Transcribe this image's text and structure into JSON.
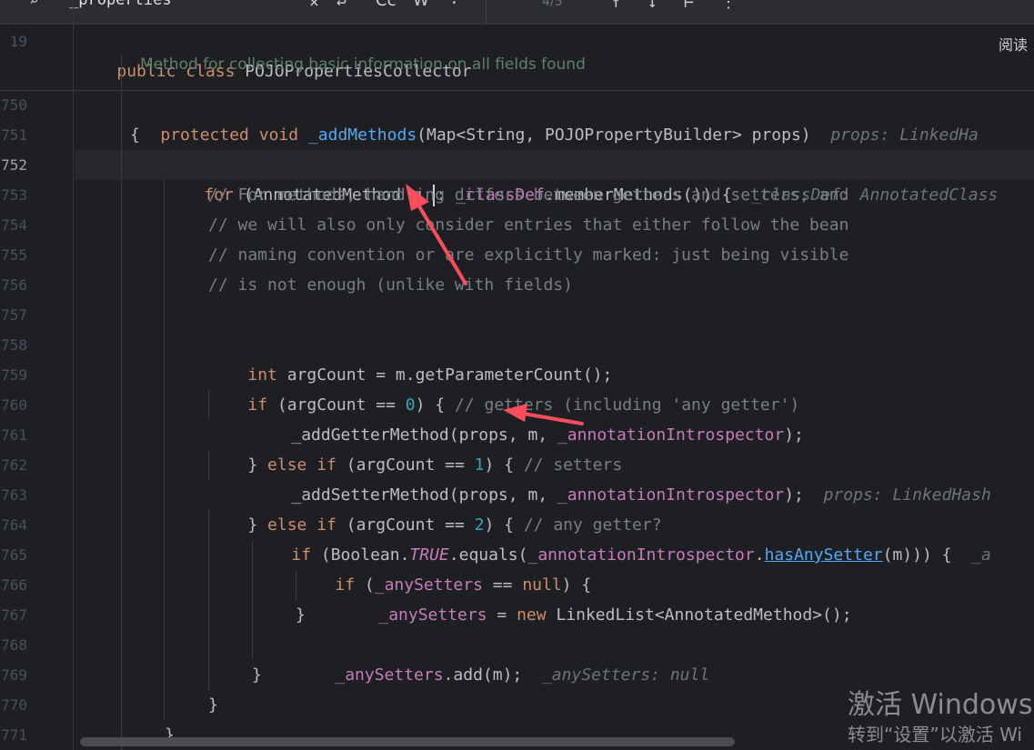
{
  "findbar": {
    "query": "_properties",
    "match_count": "4/5",
    "case_label": "Cc",
    "word_label": "W",
    "regex_label": ".*"
  },
  "sticky": {
    "line_number": "19",
    "class_decl": [
      "public",
      "class",
      "POJOPropertiesCollector"
    ],
    "doc_comment": "Method for collecting basic information on all fields found"
  },
  "side_panel_label": "阅读",
  "line_numbers": [
    "750",
    "751",
    "752",
    "753",
    "754",
    "755",
    "756",
    "757",
    "758",
    "759",
    "760",
    "761",
    "762",
    "763",
    "764",
    "765",
    "766",
    "767",
    "768",
    "769",
    "770",
    "771"
  ],
  "code": {
    "l750": {
      "kw1": "protected",
      "kw2": "void",
      "name": "_addMethods",
      "params": "(Map<String, POJOPropertyBuilder> props)",
      "hint": "props: LinkedHa"
    },
    "l751": {
      "text": "{"
    },
    "l752": {
      "kw": "for",
      "a": "(AnnotatedMethod m ",
      "b": ": ",
      "field": "_classDef",
      "c": ".memberMethods()) {",
      "hint": "_classDef: AnnotatedClass"
    },
    "l753": {
      "text": "// For methods, handling differs between getters and setters; and"
    },
    "l754": {
      "text": "// we will also only consider entries that either follow the bean"
    },
    "l755": {
      "text": "// naming convention or are explicitly marked: just being visible"
    },
    "l756": {
      "text": "// is not enough (unlike with fields)"
    },
    "l758": {
      "kw": "int",
      "rest": " argCount = m.getParameterCount();"
    },
    "l759": {
      "kw": "if",
      "a": " (argCount == ",
      "num": "0",
      "b": ") { ",
      "cmt": "// getters (including 'any getter')"
    },
    "l760": {
      "a": "_addGetterMethod(props, m, ",
      "field": "_annotationIntrospector",
      "b": ");"
    },
    "l761": {
      "a": "} ",
      "kw": "else if",
      "b": " (argCount == ",
      "num": "1",
      "c": ") { ",
      "cmt": "// setters"
    },
    "l762": {
      "a": "_addSetterMethod(props, m, ",
      "field": "_annotationIntrospector",
      "b": ");",
      "hint": "props: LinkedHash"
    },
    "l763": {
      "a": "} ",
      "kw": "else if",
      "b": " (argCount == ",
      "num": "2",
      "c": ") { ",
      "cmt": "// any getter?"
    },
    "l764": {
      "kw": "if",
      "a": " (Boolean.",
      "const": "TRUE",
      "b": ".equals(",
      "field": "_annotationIntrospector",
      "c": ".",
      "link": "hasAnySetter",
      "d": "(m))) {",
      "hint": "_a"
    },
    "l765": {
      "kw": "if",
      "a": " (",
      "field": "_anySetters",
      "b": " == ",
      "kw2": "null",
      "c": ") {"
    },
    "l766": {
      "field": "_anySetters",
      "a": " = ",
      "kw": "new",
      "b": " LinkedList<AnnotatedMethod>();"
    },
    "l767": {
      "text": "}"
    },
    "l768": {
      "field": "_anySetters",
      "a": ".add(m);",
      "hint": "_anySetters: null"
    },
    "l769": {
      "text": "}"
    },
    "l770": {
      "text": "}"
    },
    "l771": {
      "text": "}"
    }
  },
  "watermark": {
    "line1": "激活 Windows",
    "line2": "转到“设置”以激活 Wi"
  },
  "colors": {
    "annotation_arrow": "#ff4d5e"
  }
}
